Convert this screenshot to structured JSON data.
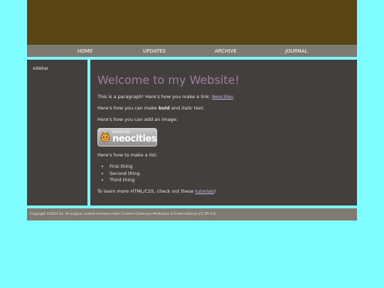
{
  "nav": {
    "items": [
      {
        "label": "HOME"
      },
      {
        "label": "UPDATES"
      },
      {
        "label": "ARCHIVE"
      },
      {
        "label": "JOURNAL"
      }
    ]
  },
  "sidebar": {
    "label": "sidebar"
  },
  "main": {
    "title": "Welcome to my Website!",
    "p1_text": "This is a paragraph! Here's how you make a link: ",
    "p1_link": "Neocities",
    "p1_end": ".",
    "p2_a": "Here's how you can make ",
    "p2_bold": "bold",
    "p2_b": " and ",
    "p2_italic": "italic",
    "p2_c": " text.",
    "p3": "Here's how you can add an image:",
    "badge_small": "hosted by",
    "badge_big": "neocities",
    "p4": "Here's how to make a list:",
    "list": [
      "First thing",
      "Second thing",
      "Third thing"
    ],
    "p5_a": "To learn more HTML/CSS, check out these ",
    "p5_link": "tutorials",
    "p5_end": "!"
  },
  "footer": {
    "text": "Copyright ©2023 Oz. All original content licensed under Creative Commons Attribution 4.0 International (CC BY 4.0)"
  },
  "colors": {
    "page_bg": "#7ffcff",
    "header": "#5a4516",
    "bars": "#7e7a72",
    "panel": "#433f3d",
    "title": "#9d7fa3",
    "link": "#c7b4e8"
  }
}
